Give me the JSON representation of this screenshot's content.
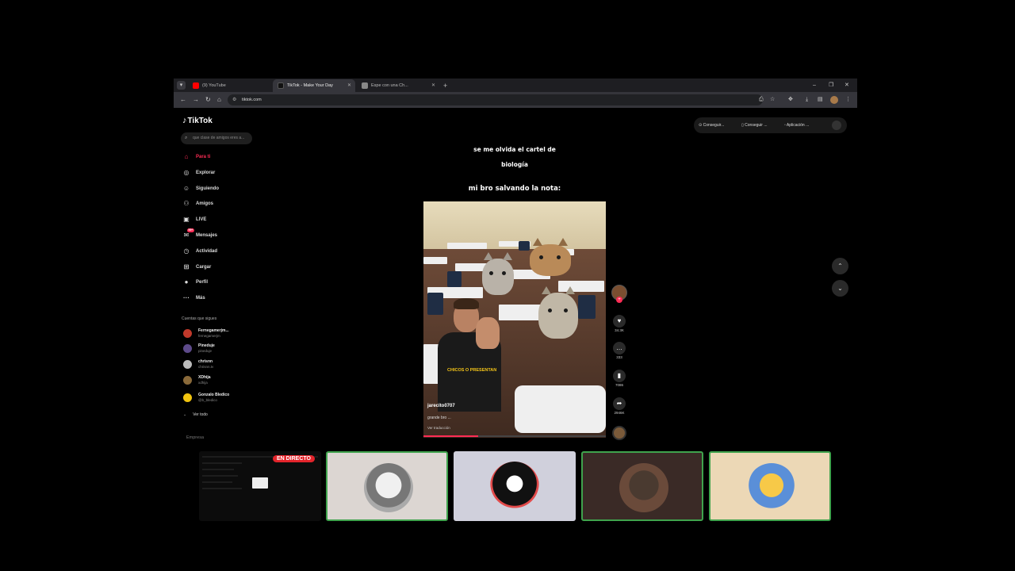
{
  "browser": {
    "tabs": [
      {
        "label": "(9) YouTube",
        "favicon_color": "#ff0000"
      },
      {
        "label": "TikTok - Make Your Day",
        "favicon_color": "#222222"
      },
      {
        "label": "Espe con una Ch...",
        "favicon_color": "#888888"
      }
    ],
    "url": "tiktok.com",
    "window_controls": {
      "minimize": "–",
      "maximize": "❐",
      "close": "✕"
    }
  },
  "tiktok": {
    "logo": "TikTok",
    "search_placeholder": "que clase de amigos eres a...",
    "nav": [
      {
        "label": "Para ti",
        "icon": "home-icon",
        "glyph": "⌂",
        "active": true
      },
      {
        "label": "Explorar",
        "icon": "compass-icon",
        "glyph": "◎"
      },
      {
        "label": "Siguiendo",
        "icon": "following-icon",
        "glyph": "☺"
      },
      {
        "label": "Amigos",
        "icon": "friends-icon",
        "glyph": "⚇"
      },
      {
        "label": "LIVE",
        "icon": "live-icon",
        "glyph": "▣"
      },
      {
        "label": "Mensajes",
        "icon": "messages-icon",
        "glyph": "✉",
        "badge": "99+"
      },
      {
        "label": "Actividad",
        "icon": "activity-icon",
        "glyph": "◷"
      },
      {
        "label": "Cargar",
        "icon": "upload-icon",
        "glyph": "⊞"
      },
      {
        "label": "Perfil",
        "icon": "profile-icon",
        "glyph": "●"
      },
      {
        "label": "Más",
        "icon": "more-icon",
        "glyph": "···"
      }
    ],
    "following_header": "Cuentas que sigues",
    "following": [
      {
        "name": "Fernegamerjm...",
        "handle": "fernegamerjm",
        "color": "#c0392b"
      },
      {
        "name": "Pineduje",
        "handle": "pineduje",
        "color": "#5d4a8a"
      },
      {
        "name": "chrisnn",
        "handle": "chrisnn.tv",
        "color": "#bbbbbb"
      },
      {
        "name": "XDhija",
        "handle": "xdhija",
        "color": "#8a6a3a"
      },
      {
        "name": "Gonzalo Bledico",
        "handle": "@b_bledico",
        "color": "#f1c40f"
      }
    ],
    "see_all": "Ver todo",
    "company": "Empresa",
    "top_buttons": [
      "Conseguir...",
      "Conseguir ...",
      "Aplicación ..."
    ],
    "caption_line1": "se me olvida el cartel de",
    "caption_line2": "biología",
    "caption_line3": "mi bro salvando la nota:",
    "video": {
      "username": "jarecito0707",
      "description": "grande bro ...",
      "translate": "Ver traducción",
      "shirt_text": "CHICOS O PRESENTAN",
      "progress": 0.3
    },
    "actions": {
      "likes": "34.3K",
      "comments": "333",
      "saves": "7086",
      "shares": "2946K"
    }
  },
  "strip": {
    "live_label": "EN DIRECTO"
  }
}
